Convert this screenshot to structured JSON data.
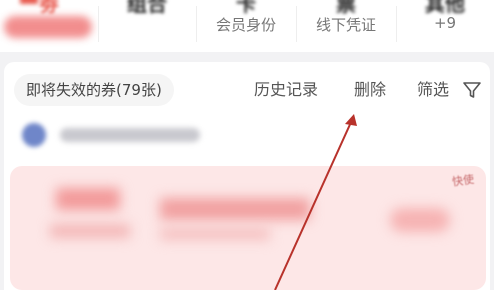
{
  "top_categories": [
    {
      "big": "劵",
      "sub": ""
    },
    {
      "big": "组合",
      "sub": ""
    },
    {
      "big": "卡",
      "sub": "会员身份"
    },
    {
      "big": "票",
      "sub": "线下凭证"
    },
    {
      "big": "其他",
      "sub": "+9"
    }
  ],
  "filter_bar": {
    "expiring_label": "即将失效的券(79张)",
    "history_label": "历史记录",
    "delete_label": "删除",
    "filter_label": "筛选"
  },
  "coupon": {
    "tag": "快使"
  },
  "colors": {
    "accent_red": "#b8322b",
    "card_pink": "#fde7e7"
  },
  "icons": {
    "filter": "funnel-icon"
  }
}
